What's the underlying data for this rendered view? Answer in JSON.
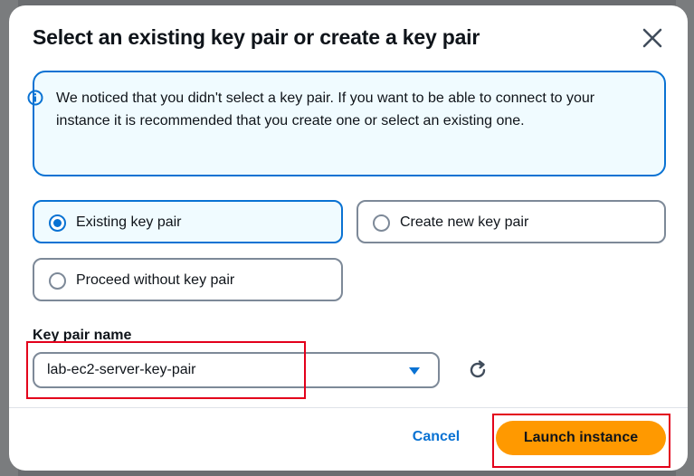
{
  "modal": {
    "title": "Select an existing key pair or create a key pair",
    "close_icon": "close-icon"
  },
  "alert": {
    "icon": "info-icon",
    "text": "We noticed that you didn't select a key pair. If you want to be able to connect to your instance it is recommended that you create one or select an existing one."
  },
  "options": [
    {
      "label": "Existing key pair",
      "selected": true
    },
    {
      "label": "Create new key pair",
      "selected": false
    },
    {
      "label": "Proceed without key pair",
      "selected": false
    }
  ],
  "key_pair": {
    "label": "Key pair name",
    "value": "lab-ec2-server-key-pair",
    "refresh_icon": "refresh-icon"
  },
  "footer": {
    "cancel_label": "Cancel",
    "launch_label": "Launch instance"
  },
  "colors": {
    "accent": "#0972d3",
    "primary_button": "#ff9900",
    "annotation": "#e3001b"
  }
}
